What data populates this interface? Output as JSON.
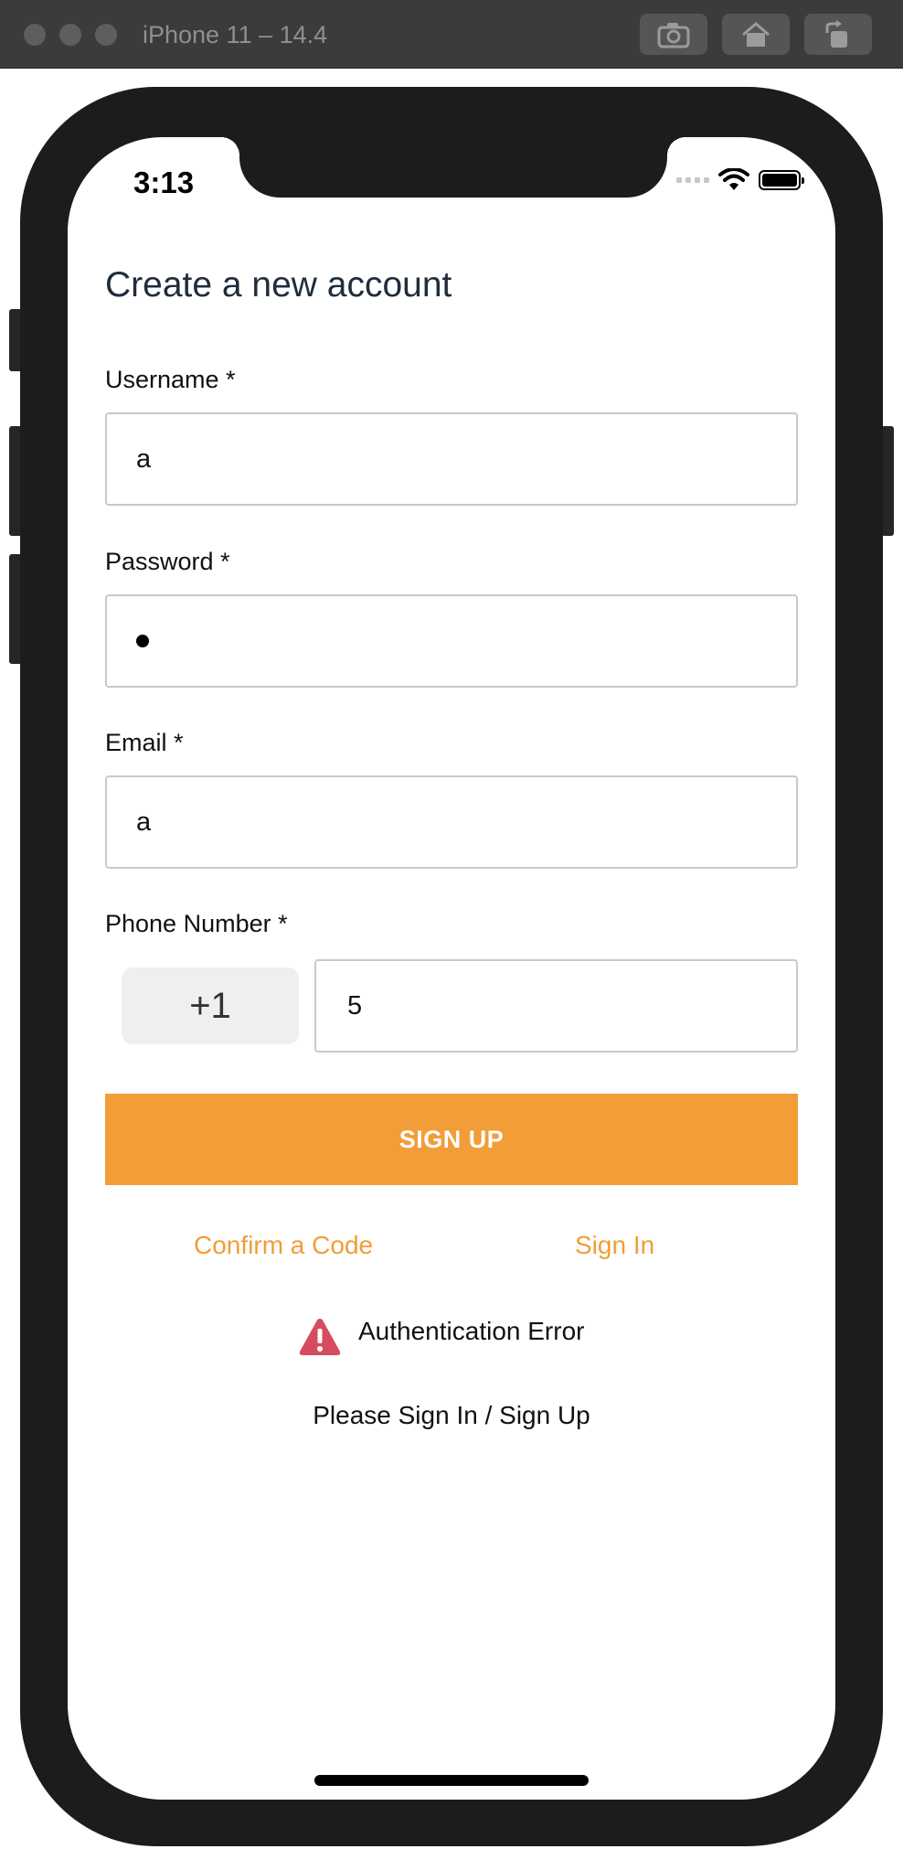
{
  "window": {
    "title": "iPhone 11 – 14.4",
    "toolbar": {
      "screenshot_icon": "camera-icon",
      "home_icon": "home-icon",
      "rotate_icon": "rotate-icon"
    }
  },
  "status_bar": {
    "time": "3:13",
    "signal_icon": "cellular-signal-icon",
    "wifi_icon": "wifi-icon",
    "battery_icon": "battery-icon"
  },
  "form": {
    "title": "Create a new account",
    "username": {
      "label": "Username *",
      "value": "a"
    },
    "password": {
      "label": "Password *",
      "value_masked": "•"
    },
    "email": {
      "label": "Email *",
      "value": "a"
    },
    "phone": {
      "label": "Phone Number *",
      "dial_code": "+1",
      "value": "5"
    },
    "submit_label": "SIGN UP",
    "links": {
      "confirm_code": "Confirm a Code",
      "sign_in": "Sign In"
    }
  },
  "error": {
    "icon": "warning-triangle-icon",
    "title": "Authentication Error",
    "message": "Please Sign In / Sign Up"
  },
  "colors": {
    "accent": "#f29d38",
    "error_icon": "#d64c5e",
    "title_text": "#1f2d3d",
    "device_frame": "#1c1c1e",
    "field_border": "#c9c9c9",
    "dial_bg": "#efeff2"
  }
}
